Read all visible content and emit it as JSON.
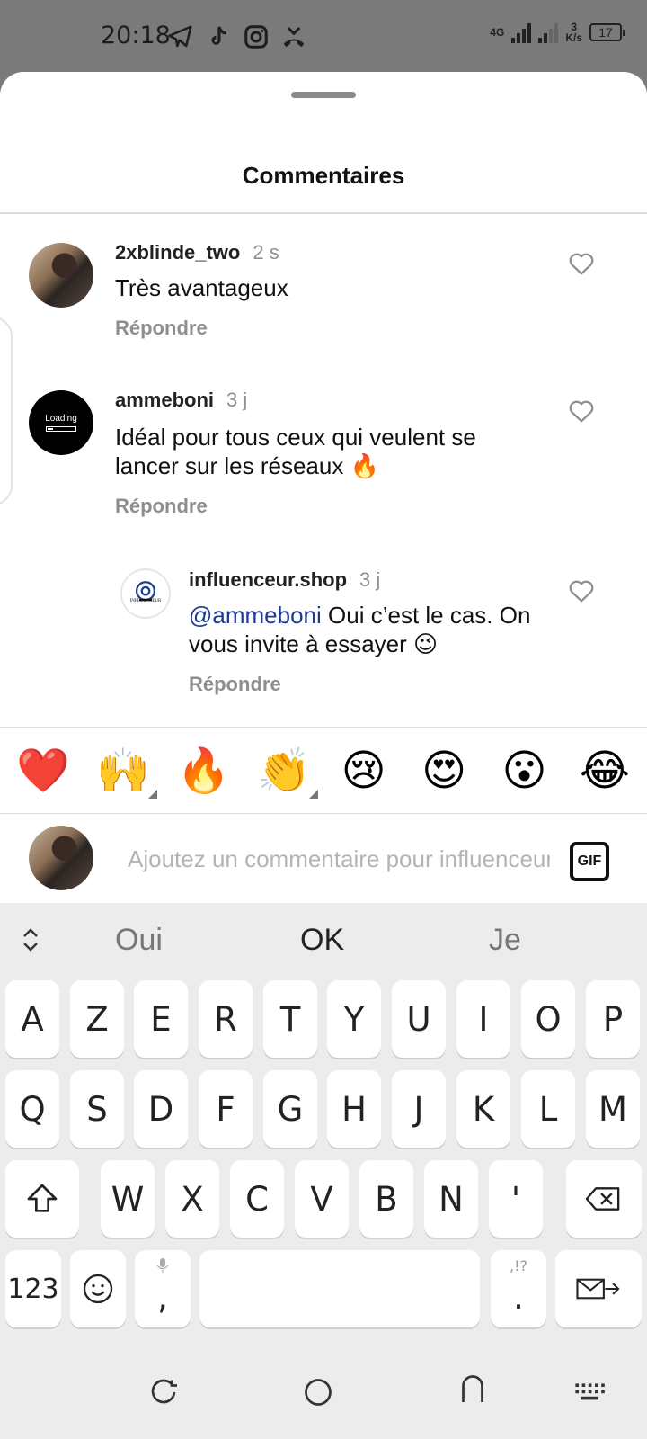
{
  "status_bar": {
    "time": "20:18",
    "network_speed": "3",
    "network_unit": "K/s",
    "battery": "17",
    "network_type": "4G",
    "icons": [
      "telegram-icon",
      "tiktok-icon",
      "instagram-icon",
      "missed-call-icon"
    ]
  },
  "sheet": {
    "title": "Commentaires"
  },
  "comments": [
    {
      "username": "2xblinde_two",
      "time": "2 s",
      "text": "Très avantageux",
      "reply_label": "Répondre",
      "avatar": "photo"
    },
    {
      "username": "ammeboni",
      "time": "3 j",
      "text": "Idéal pour tous ceux qui veulent se lancer sur les réseaux 🔥",
      "reply_label": "Répondre",
      "avatar": "loading",
      "avatar_text": "Loading"
    },
    {
      "username": "influenceur.shop",
      "time": "3 j",
      "mention": "@ammeboni",
      "text": " Oui c’est le cas. On vous invite à essayer 😉",
      "reply_label": "Répondre",
      "avatar": "brand",
      "avatar_text": "INFLUENCEUR"
    }
  ],
  "emoji_bar": [
    "❤️",
    "🙌",
    "🔥",
    "👏",
    "😢",
    "😍",
    "😮",
    "😂"
  ],
  "composer": {
    "placeholder": "Ajoutez un commentaire pour influenceur.shop…",
    "gif_label": "GIF"
  },
  "keyboard": {
    "suggestions": [
      "Oui",
      "OK",
      "Je"
    ],
    "row1": [
      "A",
      "Z",
      "E",
      "R",
      "T",
      "Y",
      "U",
      "I",
      "O",
      "P"
    ],
    "row2": [
      "Q",
      "S",
      "D",
      "F",
      "G",
      "H",
      "J",
      "K",
      "L",
      "M"
    ],
    "row3": [
      "W",
      "X",
      "C",
      "V",
      "B",
      "N",
      "'"
    ],
    "numbers_label": "123",
    "comma_label": ",",
    "period_label": ".",
    "period_hint": ",!?"
  },
  "colors": {
    "mention": "#1f3a93",
    "secondary_text": "#8e8e8e",
    "keyboard_bg": "#ececec"
  }
}
